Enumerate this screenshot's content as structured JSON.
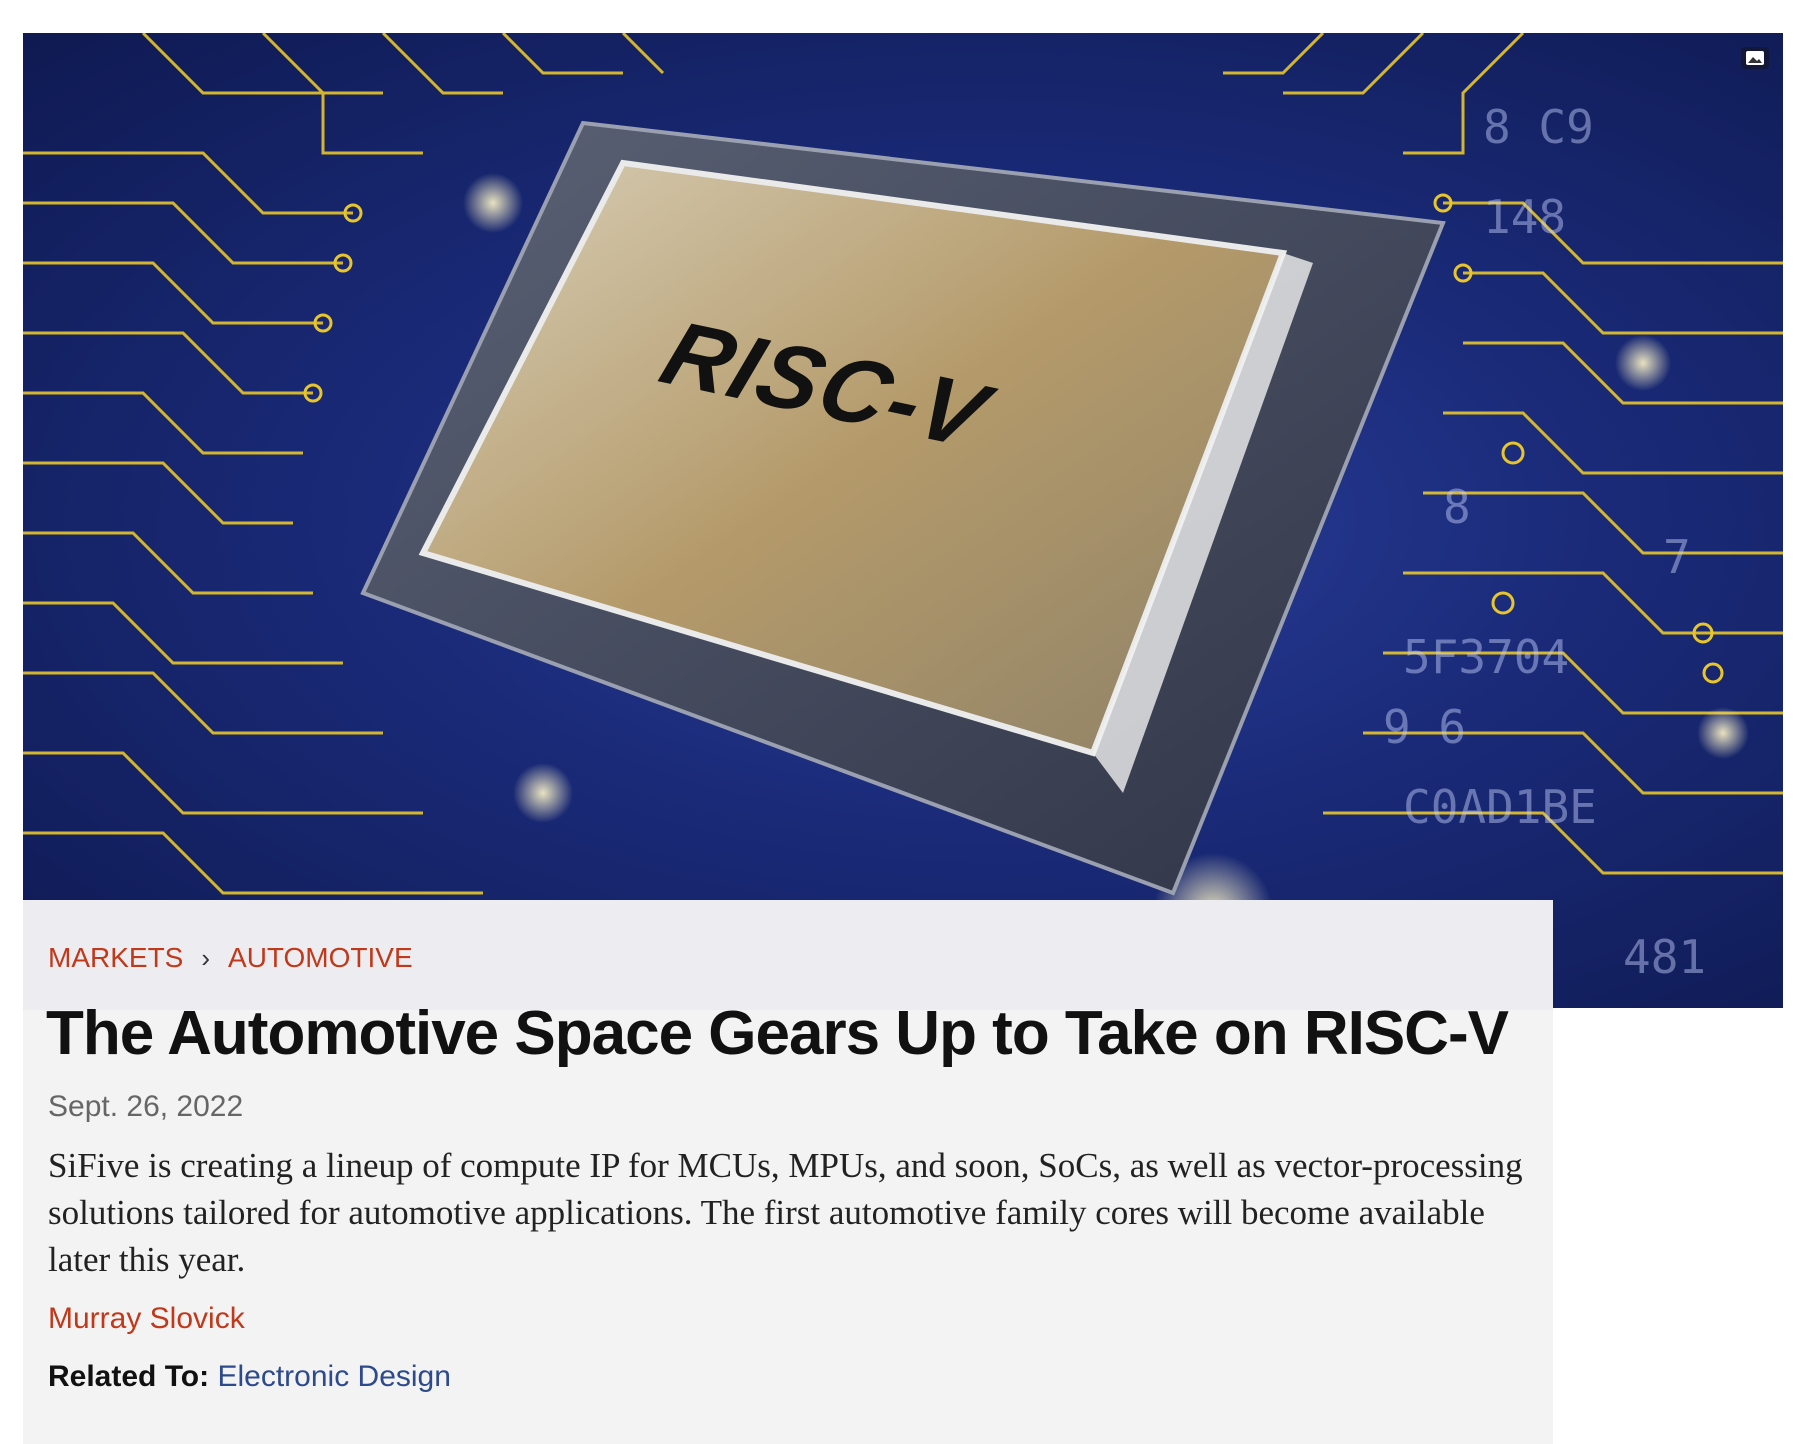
{
  "hero": {
    "chip_text": "RISC-V",
    "expand_icon": "image-icon",
    "colors": {
      "board": "#1a2a78",
      "traces": "#e8c62a",
      "chip": "#b9a98a"
    }
  },
  "breadcrumb": {
    "items": [
      "MARKETS",
      "AUTOMOTIVE"
    ],
    "separator_icon": "chevron-right-icon"
  },
  "article": {
    "title": "The Automotive Space Gears Up to Take on RISC-V",
    "date": "Sept. 26, 2022",
    "summary": "SiFive is creating a lineup of compute IP for MCUs, MPUs, and soon, SoCs, as well as vector-processing solutions tailored for automotive applications. The first automotive family cores will become available later this year.",
    "author": "Murray Slovick",
    "related_label": "Related To:",
    "related_link": "Electronic Design"
  },
  "colors": {
    "accent": "#c0391b",
    "link": "#2c4a8c",
    "card_bg": "#f3f3f3"
  }
}
